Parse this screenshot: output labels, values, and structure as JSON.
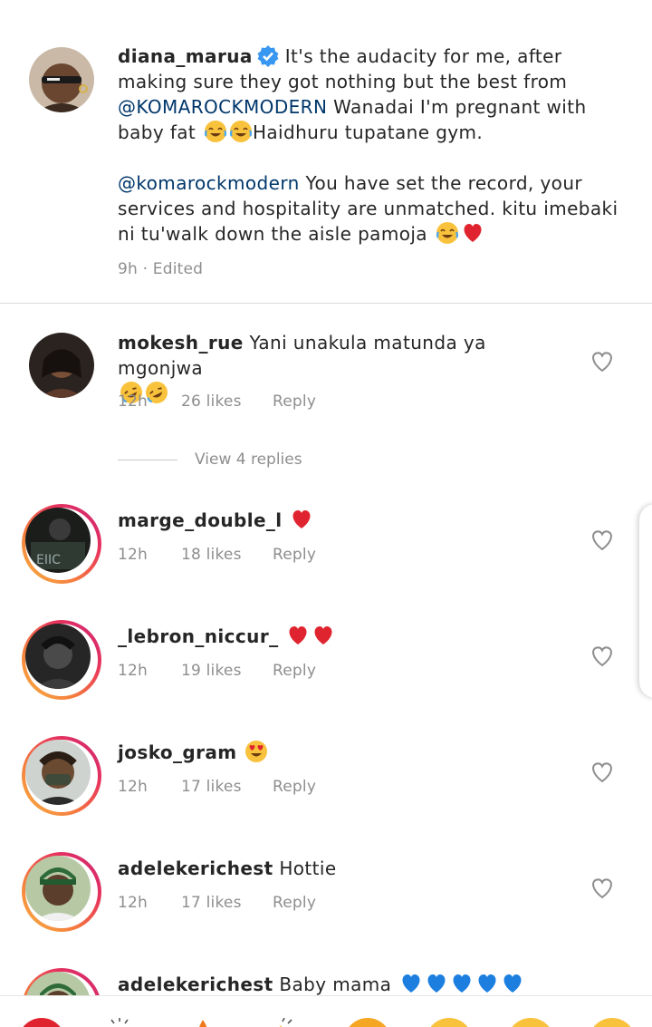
{
  "caption": {
    "username": "diana_marua",
    "text_1": "It's the audacity for me, after making sure they got nothing but the best from",
    "mention_1": "@KOMAROCKMODERN",
    "text_2": "Wanadai I'm pregnant with baby fat",
    "text_3": "Haidhuru tupatane gym.",
    "mention_2": "@komarockmodern",
    "text_4": "You have set the record, your services and hospitality are unmatched. kitu imebaki ni tu'walk down the aisle pamoja",
    "meta": "9h · Edited"
  },
  "comments": [
    {
      "username": "mokesh_rue",
      "text": "Yani unakula matunda ya mgonjwa",
      "emojis": [
        "rofl-emoji",
        "rofl-emoji"
      ],
      "time": "12h",
      "likes": "26 likes",
      "reply": "Reply"
    },
    {
      "username": "marge_double_l",
      "text": "",
      "emojis": [
        "red-heart-emoji"
      ],
      "time": "12h",
      "likes": "18 likes",
      "reply": "Reply"
    },
    {
      "username": "_lebron_niccur_",
      "text": "",
      "emojis": [
        "red-heart-emoji",
        "red-heart-emoji"
      ],
      "time": "12h",
      "likes": "19 likes",
      "reply": "Reply"
    },
    {
      "username": "josko_gram",
      "text": "",
      "emojis": [
        "heart-eyes-emoji"
      ],
      "time": "12h",
      "likes": "17 likes",
      "reply": "Reply"
    },
    {
      "username": "adelekerichest",
      "text": "Hottie",
      "emojis": [],
      "time": "12h",
      "likes": "17 likes",
      "reply": "Reply"
    },
    {
      "username": "adelekerichest",
      "text": "Baby mama",
      "emojis": [
        "blue-heart-emoji",
        "blue-heart-emoji",
        "blue-heart-emoji",
        "blue-heart-emoji",
        "blue-heart-emoji"
      ],
      "time": "",
      "likes": "",
      "reply": ""
    }
  ],
  "view_replies": "View 4 replies",
  "colors": {
    "mention": "#00376b",
    "meta": "#8e8e8e",
    "verified": "#3897f0",
    "red_heart": "#e0242f",
    "blue_heart": "#1c7fe0"
  },
  "icons": [
    "verified-badge-icon",
    "heart-outline-icon"
  ],
  "reaction_bar": [
    "red-heart-emoji",
    "raised-hands-emoji",
    "fire-emoji",
    "clap-emoji",
    "crying-emoji",
    "heart-eyes-emoji",
    "surprised-emoji",
    "laughing-emoji"
  ]
}
